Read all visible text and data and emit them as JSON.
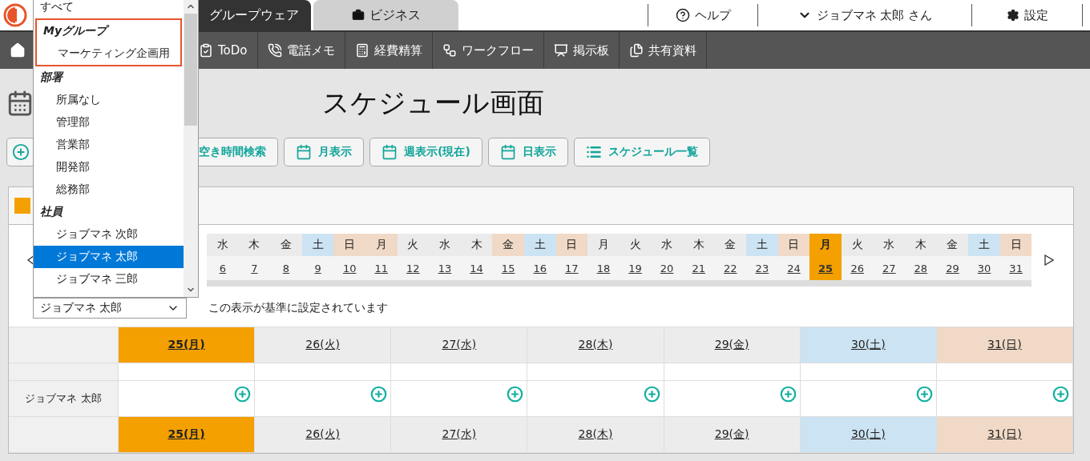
{
  "tabs": [
    {
      "label": "グループウェア",
      "selected": true
    },
    {
      "label": "ビジネス",
      "selected": false
    }
  ],
  "header_links": [
    {
      "kind": "help",
      "label": "ヘルプ"
    },
    {
      "kind": "user",
      "label": "ジョブマネ 太郎 さん"
    },
    {
      "kind": "settings",
      "label": "設定"
    }
  ],
  "nav": [
    {
      "kind": "todo",
      "label": "ToDo"
    },
    {
      "kind": "phone",
      "label": "電話メモ"
    },
    {
      "kind": "calculator",
      "label": "経費精算"
    },
    {
      "kind": "workflow",
      "label": "ワークフロー"
    },
    {
      "kind": "board",
      "label": "掲示板"
    },
    {
      "kind": "files",
      "label": "共有資料"
    }
  ],
  "page_title": "スケジュール画面",
  "toolbar": [
    {
      "kind": "search",
      "label": "空き時間検索"
    },
    {
      "kind": "calendar",
      "label": "月表示"
    },
    {
      "kind": "calendar",
      "label": "週表示(現在)"
    },
    {
      "kind": "calendar",
      "label": "日表示"
    },
    {
      "kind": "list",
      "label": "スケジュール一覧"
    }
  ],
  "date_strip": [
    {
      "weekday": "水",
      "date": "6",
      "kind": "weekday"
    },
    {
      "weekday": "木",
      "date": "7",
      "kind": "weekday"
    },
    {
      "weekday": "金",
      "date": "8",
      "kind": "weekday"
    },
    {
      "weekday": "土",
      "date": "9",
      "kind": "saturday"
    },
    {
      "weekday": "日",
      "date": "10",
      "kind": "holiday"
    },
    {
      "weekday": "月",
      "date": "11",
      "kind": "holiday"
    },
    {
      "weekday": "火",
      "date": "12",
      "kind": "weekday"
    },
    {
      "weekday": "水",
      "date": "13",
      "kind": "weekday"
    },
    {
      "weekday": "木",
      "date": "14",
      "kind": "weekday"
    },
    {
      "weekday": "金",
      "date": "15",
      "kind": "holiday"
    },
    {
      "weekday": "土",
      "date": "16",
      "kind": "saturday"
    },
    {
      "weekday": "日",
      "date": "17",
      "kind": "holiday"
    },
    {
      "weekday": "月",
      "date": "18",
      "kind": "weekday"
    },
    {
      "weekday": "火",
      "date": "19",
      "kind": "weekday"
    },
    {
      "weekday": "水",
      "date": "20",
      "kind": "weekday"
    },
    {
      "weekday": "木",
      "date": "21",
      "kind": "weekday"
    },
    {
      "weekday": "金",
      "date": "22",
      "kind": "weekday"
    },
    {
      "weekday": "土",
      "date": "23",
      "kind": "saturday"
    },
    {
      "weekday": "日",
      "date": "24",
      "kind": "holiday"
    },
    {
      "weekday": "月",
      "date": "25",
      "kind": "today"
    },
    {
      "weekday": "火",
      "date": "26",
      "kind": "weekday"
    },
    {
      "weekday": "水",
      "date": "27",
      "kind": "weekday"
    },
    {
      "weekday": "木",
      "date": "28",
      "kind": "weekday"
    },
    {
      "weekday": "金",
      "date": "29",
      "kind": "weekday"
    },
    {
      "weekday": "土",
      "date": "30",
      "kind": "saturday"
    },
    {
      "weekday": "日",
      "date": "31",
      "kind": "holiday"
    }
  ],
  "user_select": {
    "value": "ジョブマネ 太郎"
  },
  "note": "この表示が基準に設定されています",
  "week": {
    "days": [
      {
        "label": "25(月)",
        "kind": "today"
      },
      {
        "label": "26(火)",
        "kind": "weekday"
      },
      {
        "label": "27(水)",
        "kind": "weekday"
      },
      {
        "label": "28(木)",
        "kind": "weekday"
      },
      {
        "label": "29(金)",
        "kind": "weekday"
      },
      {
        "label": "30(土)",
        "kind": "saturday"
      },
      {
        "label": "31(日)",
        "kind": "holiday"
      }
    ],
    "footer_days": [
      {
        "label": "25(月)",
        "kind": "today"
      },
      {
        "label": "26(火)",
        "kind": "weekday"
      },
      {
        "label": "27(水)",
        "kind": "weekday"
      },
      {
        "label": "28(木)",
        "kind": "weekday"
      },
      {
        "label": "29(金)",
        "kind": "weekday"
      },
      {
        "label": "30(土)",
        "kind": "saturday"
      },
      {
        "label": "31(日)",
        "kind": "holiday"
      }
    ],
    "rows": [
      {
        "name": "ジョブマネ 太郎"
      }
    ]
  },
  "dropdown": {
    "items": [
      {
        "kind": "option",
        "label": "すべて",
        "selected": false
      },
      {
        "kind": "group",
        "label": "Myグループ",
        "highlighted": true,
        "children": [
          {
            "label": "マーケティング企画用",
            "selected": false
          }
        ]
      },
      {
        "kind": "group",
        "label": "部署",
        "children": [
          {
            "label": "所属なし",
            "selected": false
          },
          {
            "label": "管理部",
            "selected": false
          },
          {
            "label": "営業部",
            "selected": false
          },
          {
            "label": "開発部",
            "selected": false
          },
          {
            "label": "総務部",
            "selected": false
          }
        ]
      },
      {
        "kind": "group",
        "label": "社員",
        "children": [
          {
            "label": "ジョブマネ 次郎",
            "selected": false
          },
          {
            "label": "ジョブマネ 太郎",
            "selected": true
          },
          {
            "label": "ジョブマネ 三郎",
            "selected": false
          }
        ]
      }
    ]
  }
}
